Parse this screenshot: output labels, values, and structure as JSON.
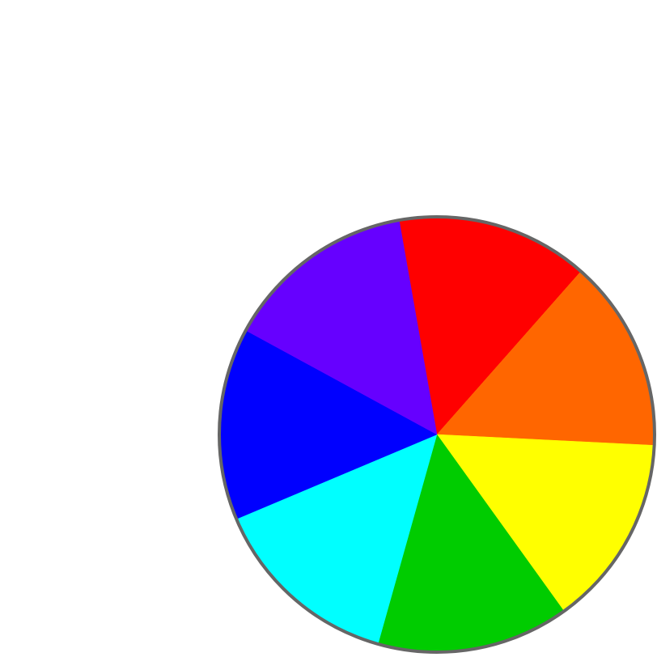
{
  "color_wheel": {
    "rim_color": "#666666",
    "segments": [
      {
        "color": "#ff0000"
      },
      {
        "color": "#ff6600"
      },
      {
        "color": "#ffff00"
      },
      {
        "color": "#00cc00"
      },
      {
        "color": "#00ffff"
      },
      {
        "color": "#0000ff"
      },
      {
        "color": "#6600ff"
      }
    ]
  }
}
